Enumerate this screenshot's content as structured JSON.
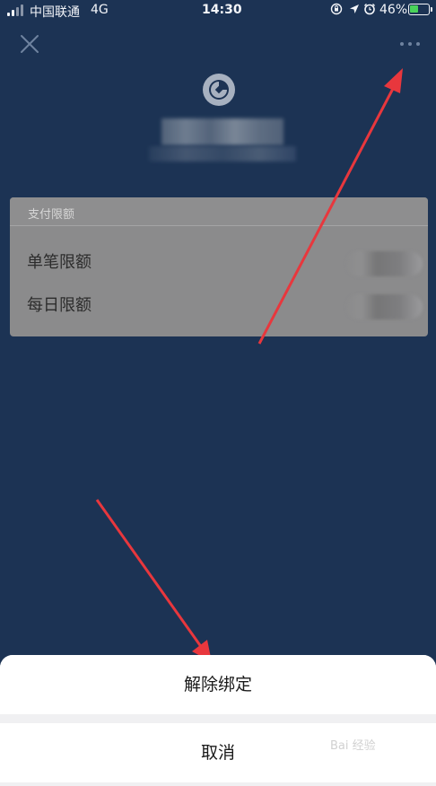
{
  "status_bar": {
    "carrier": "中国联通",
    "network": "4G",
    "time": "14:30",
    "battery_percent": "46%",
    "battery_color": "#49d35a",
    "icons": [
      "orientation-lock-icon",
      "location-arrow-icon",
      "alarm-icon"
    ]
  },
  "header": {
    "close_icon": "close-icon",
    "more_icon": "more-dots-icon",
    "bank_logo": "bank-logo-icon"
  },
  "limits": {
    "title": "支付限额",
    "rows": [
      {
        "label": "单笔限额"
      },
      {
        "label": "每日限额"
      }
    ]
  },
  "sheet": {
    "unbind_label": "解除绑定",
    "cancel_label": "取消"
  },
  "watermark": {
    "text": "Bai 经验"
  },
  "colors": {
    "background": "#1c3354",
    "annotation_arrow": "#e8373d"
  }
}
